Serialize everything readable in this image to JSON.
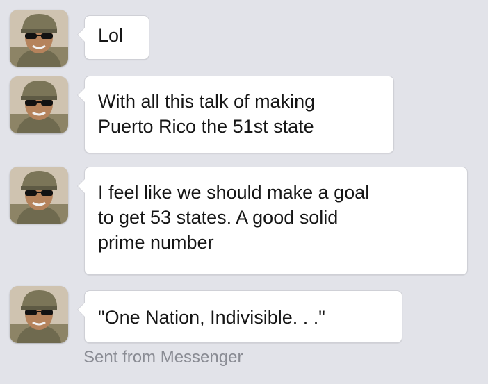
{
  "messages": [
    {
      "lines": [
        "Lol"
      ]
    },
    {
      "lines": [
        "With all this talk of making",
        "Puerto Rico the 51st state"
      ]
    },
    {
      "lines": [
        "I feel like we should make a goal",
        "to get 53 states. A good solid",
        "prime number"
      ]
    },
    {
      "lines": [
        "\"One Nation, Indivisible. . .\""
      ]
    }
  ],
  "status": {
    "text": "Sent from Messenger"
  },
  "sender": {
    "avatar_icon": "soldier-avatar-icon"
  },
  "colors": {
    "background": "#e2e3e9",
    "bubble": "#ffffff",
    "status_text": "#8a8c94"
  }
}
